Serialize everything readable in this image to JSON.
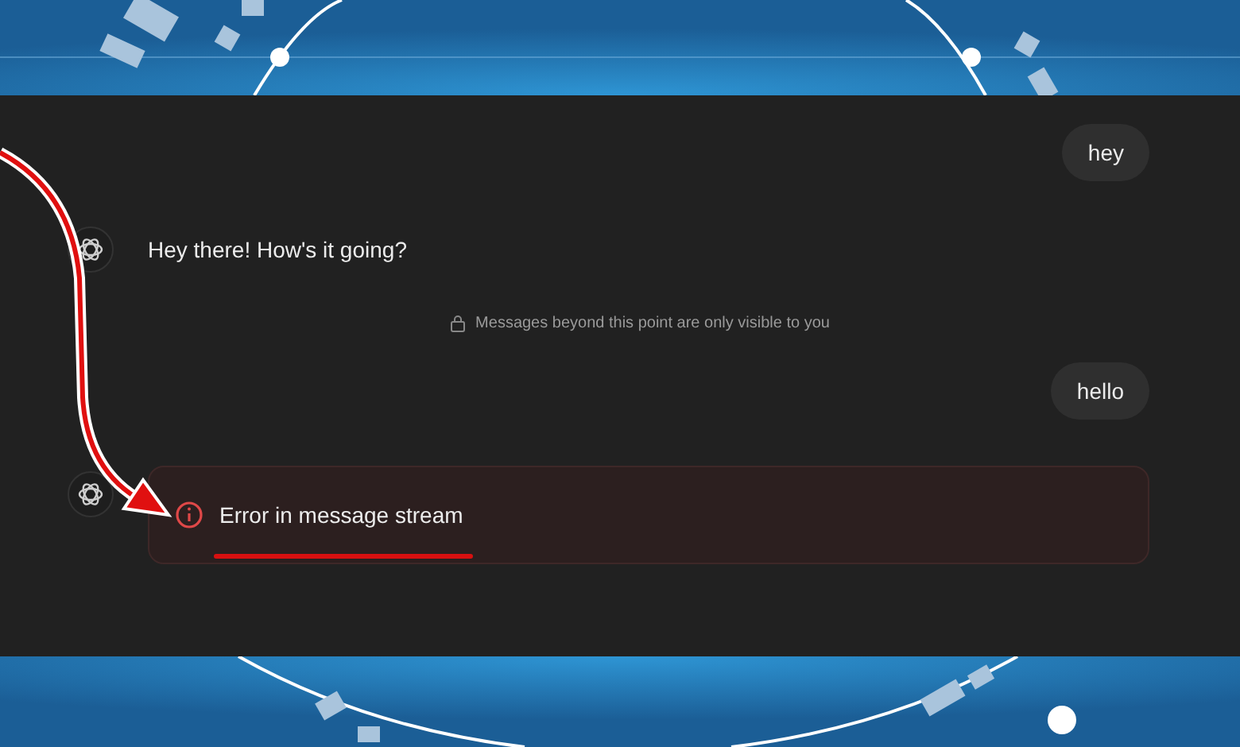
{
  "messages": [
    {
      "kind": "user",
      "text": "hey"
    },
    {
      "kind": "assistant",
      "text": "Hey there! How's it going?"
    },
    {
      "kind": "notice",
      "text": "Messages beyond this point are only visible to you"
    },
    {
      "kind": "user",
      "text": "hello"
    },
    {
      "kind": "error",
      "text": "Error in message stream"
    }
  ]
}
